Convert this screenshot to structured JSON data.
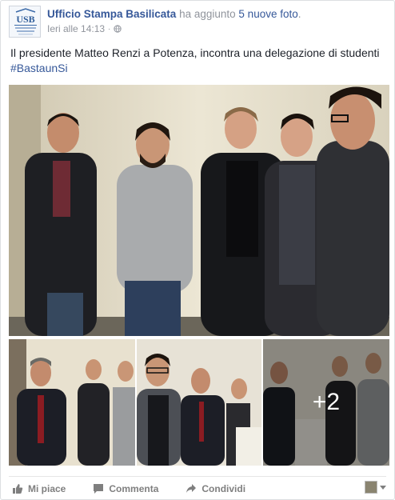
{
  "post": {
    "page_name": "Ufficio Stampa Basilicata",
    "action_text": "ha aggiunto",
    "photo_count_link": "5 nuove foto",
    "action_suffix": ".",
    "timestamp": "Ieri alle 14:13",
    "separator": "·",
    "privacy_icon": "globe-icon",
    "message": "Il presidente Matteo Renzi a Potenza, incontra una delegazione di studenti",
    "hashtag": "#BastaunSi",
    "avatar_logo": "USB",
    "avatar_tagline": "Ufficio Stampa Basilicata"
  },
  "photos": {
    "more_count": "+2"
  },
  "actions": {
    "like_label": "Mi piace",
    "comment_label": "Commenta",
    "share_label": "Condividi",
    "like_icon": "thumbs-up-icon",
    "comment_icon": "comment-bubble-icon",
    "share_icon": "share-arrow-icon"
  },
  "colors": {
    "link": "#365899",
    "muted": "#90949c",
    "action": "#7f7f7f"
  }
}
